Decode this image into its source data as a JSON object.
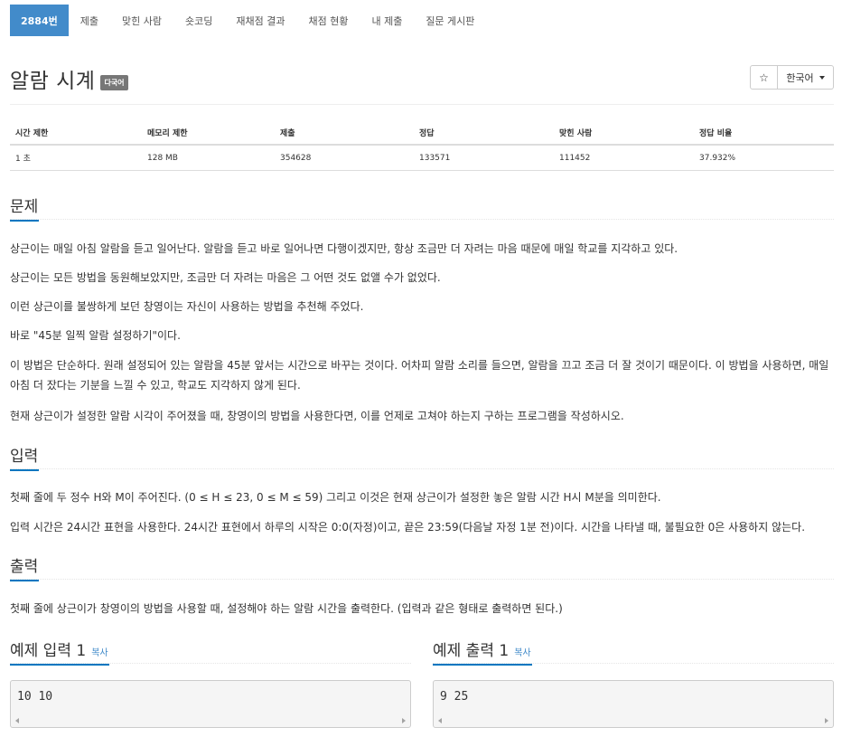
{
  "nav": {
    "tabs": [
      {
        "label": "2884번",
        "active": true
      },
      {
        "label": "제출"
      },
      {
        "label": "맞힌 사람"
      },
      {
        "label": "숏코딩"
      },
      {
        "label": "재채점 결과"
      },
      {
        "label": "채점 현황"
      },
      {
        "label": "내 제출"
      },
      {
        "label": "질문 게시판"
      }
    ]
  },
  "problem": {
    "title": "알람 시계",
    "badge": "다국어",
    "star": "☆",
    "language": "한국어"
  },
  "info": {
    "headers": [
      "시간 제한",
      "메모리 제한",
      "제출",
      "정답",
      "맞힌 사람",
      "정답 비율"
    ],
    "values": [
      "1 초",
      "128 MB",
      "354628",
      "133571",
      "111452",
      "37.932%"
    ]
  },
  "sections": {
    "problem_title": "문제",
    "problem_paras": [
      "상근이는 매일 아침 알람을 듣고 일어난다. 알람을 듣고 바로 일어나면 다행이겠지만, 항상 조금만 더 자려는 마음 때문에 매일 학교를 지각하고 있다.",
      "상근이는 모든 방법을 동원해보았지만, 조금만 더 자려는 마음은 그 어떤 것도 없앨 수가 없었다.",
      "이런 상근이를 불쌍하게 보던 창영이는 자신이 사용하는 방법을 추천해 주었다.",
      "바로 \"45분 일찍 알람 설정하기\"이다.",
      "이 방법은 단순하다. 원래 설정되어 있는 알람을 45분 앞서는 시간으로 바꾸는 것이다. 어차피 알람 소리를 들으면, 알람을 끄고 조금 더 잘 것이기 때문이다. 이 방법을 사용하면, 매일 아침 더 잤다는 기분을 느낄 수 있고, 학교도 지각하지 않게 된다.",
      "현재 상근이가 설정한 알람 시각이 주어졌을 때, 창영이의 방법을 사용한다면, 이를 언제로 고쳐야 하는지 구하는 프로그램을 작성하시오."
    ],
    "input_title": "입력",
    "input_paras": [
      "첫째 줄에 두 정수 H와 M이 주어진다. (0 ≤ H ≤ 23, 0 ≤ M ≤ 59) 그리고 이것은 현재 상근이가 설정한 놓은 알람 시간 H시 M분을 의미한다.",
      "입력 시간은 24시간 표현을 사용한다. 24시간 표현에서 하루의 시작은 0:0(자정)이고, 끝은 23:59(다음날 자정 1분 전)이다. 시간을 나타낼 때, 불필요한 0은 사용하지 않는다."
    ],
    "output_title": "출력",
    "output_paras": [
      "첫째 줄에 상근이가 창영이의 방법을 사용할 때, 설정해야 하는 알람 시간을 출력한다. (입력과 같은 형태로 출력하면 된다.)"
    ]
  },
  "samples": {
    "input_title": "예제 입력 1",
    "output_title": "예제 출력 1",
    "copy_label": "복사",
    "input_value": "10 10",
    "output_value": "9 25"
  }
}
